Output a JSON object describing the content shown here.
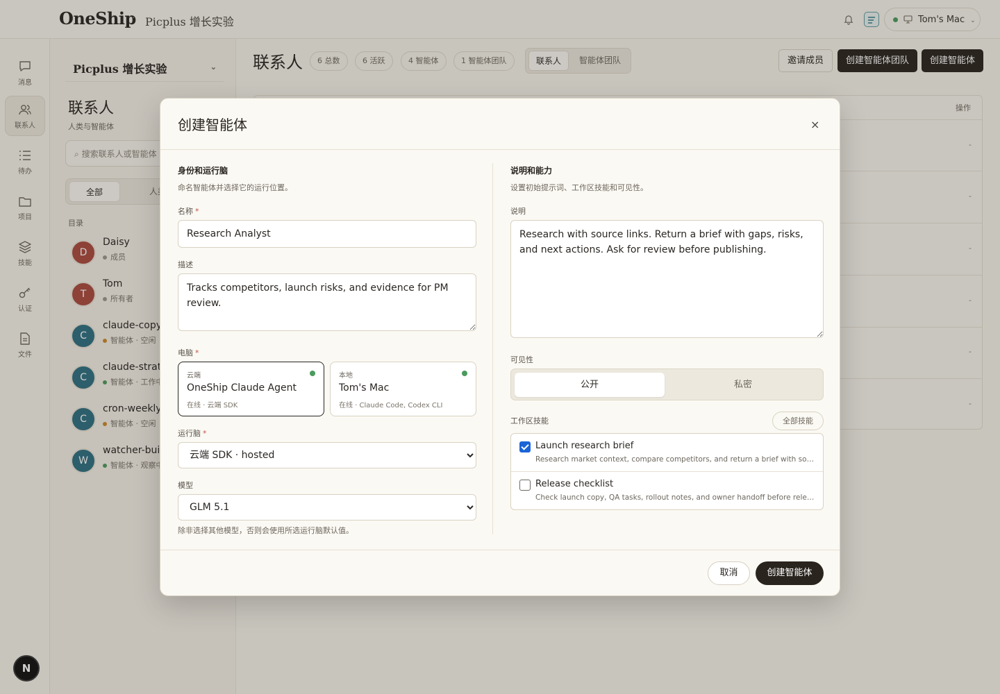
{
  "topbar": {
    "logo": "OneShip",
    "separator": "·",
    "workspace": "Picplus 增长实验",
    "machine": "Tom's Mac"
  },
  "rail": {
    "items": [
      {
        "label": "消息",
        "icon": "message-icon"
      },
      {
        "label": "联系人",
        "icon": "contacts-icon",
        "active": true
      },
      {
        "label": "待办",
        "icon": "todo-icon"
      },
      {
        "label": "项目",
        "icon": "folder-icon"
      },
      {
        "label": "技能",
        "icon": "layers-icon"
      },
      {
        "label": "认证",
        "icon": "key-icon"
      },
      {
        "label": "文件",
        "icon": "file-icon"
      }
    ],
    "avatar": "N"
  },
  "sidebar": {
    "workspace": "Picplus 增长实验",
    "title": "联系人",
    "subtitle": "人类与智能体",
    "search_placeholder": "搜索联系人或智能体",
    "seg_all": "全部",
    "seg_human": "人类",
    "dir_label": "目录",
    "contacts": [
      {
        "initial": "D",
        "name": "Daisy",
        "status": "成员",
        "color": "#a94a3e",
        "dot": "#9c968c"
      },
      {
        "initial": "T",
        "name": "Tom",
        "status": "所有者",
        "color": "#a94a3e",
        "dot": "#9c968c"
      },
      {
        "initial": "C",
        "name": "claude-copy",
        "status": "智能体 · 空闲",
        "color": "#2f6f80",
        "dot": "#c98a2a"
      },
      {
        "initial": "C",
        "name": "claude-strat",
        "status": "智能体 · 工作中",
        "color": "#2f6f80",
        "dot": "#4c9a5d"
      },
      {
        "initial": "C",
        "name": "cron-weekly",
        "status": "智能体 · 空闲",
        "color": "#2f6f80",
        "dot": "#c98a2a"
      },
      {
        "initial": "W",
        "name": "watcher-build",
        "status": "智能体 · 观察中",
        "color": "#2f6f80",
        "dot": "#4c9a5d"
      }
    ]
  },
  "main": {
    "title": "联系人",
    "chips": [
      "6 总数",
      "6 活跃",
      "4 智能体",
      "1 智能体团队"
    ],
    "tab_contacts": "联系人",
    "tab_teams": "智能体团队",
    "invite": "邀请成员",
    "create_team": "创建智能体团队",
    "create_agent": "创建智能体",
    "col_ops": "操作",
    "row_dash": "-"
  },
  "modal": {
    "title": "创建智能体",
    "close": "×",
    "left": {
      "heading": "身份和运行脑",
      "sub": "命名智能体并选择它的运行位置。",
      "name_label": "名称",
      "name_value": "Research Analyst",
      "desc_label": "描述",
      "desc_value": "Tracks competitors, launch risks, and evidence for PM review.",
      "computer_label": "电脑",
      "cards": [
        {
          "kind": "云端",
          "name": "OneShip Claude Agent",
          "status": "在线 · 云端 SDK",
          "selected": true
        },
        {
          "kind": "本地",
          "name": "Tom's Mac",
          "status": "在线 · Claude Code, Codex CLI",
          "selected": false
        }
      ],
      "runtime_label": "运行脑",
      "runtime_value": "云端 SDK · hosted",
      "model_label": "模型",
      "model_value": "GLM 5.1",
      "hint": "除非选择其他模型，否则会使用所选运行脑默认值。",
      "required": "*"
    },
    "right": {
      "heading": "说明和能力",
      "sub": "设置初始提示词、工作区技能和可见性。",
      "instr_label": "说明",
      "instr_value": "Research with source links. Return a brief with gaps, risks, and next actions. Ask for review before publishing.",
      "vis_label": "可见性",
      "vis_public": "公开",
      "vis_private": "私密",
      "skills_label": "工作区技能",
      "all_skills": "全部技能",
      "skills": [
        {
          "title": "Launch research brief",
          "desc": "Research market context, compare competitors, and return a brief with sources.",
          "checked": true
        },
        {
          "title": "Release checklist",
          "desc": "Check launch copy, QA tasks, rollout notes, and owner handoff before release.",
          "checked": false
        }
      ]
    },
    "cancel": "取消",
    "submit": "创建智能体"
  }
}
